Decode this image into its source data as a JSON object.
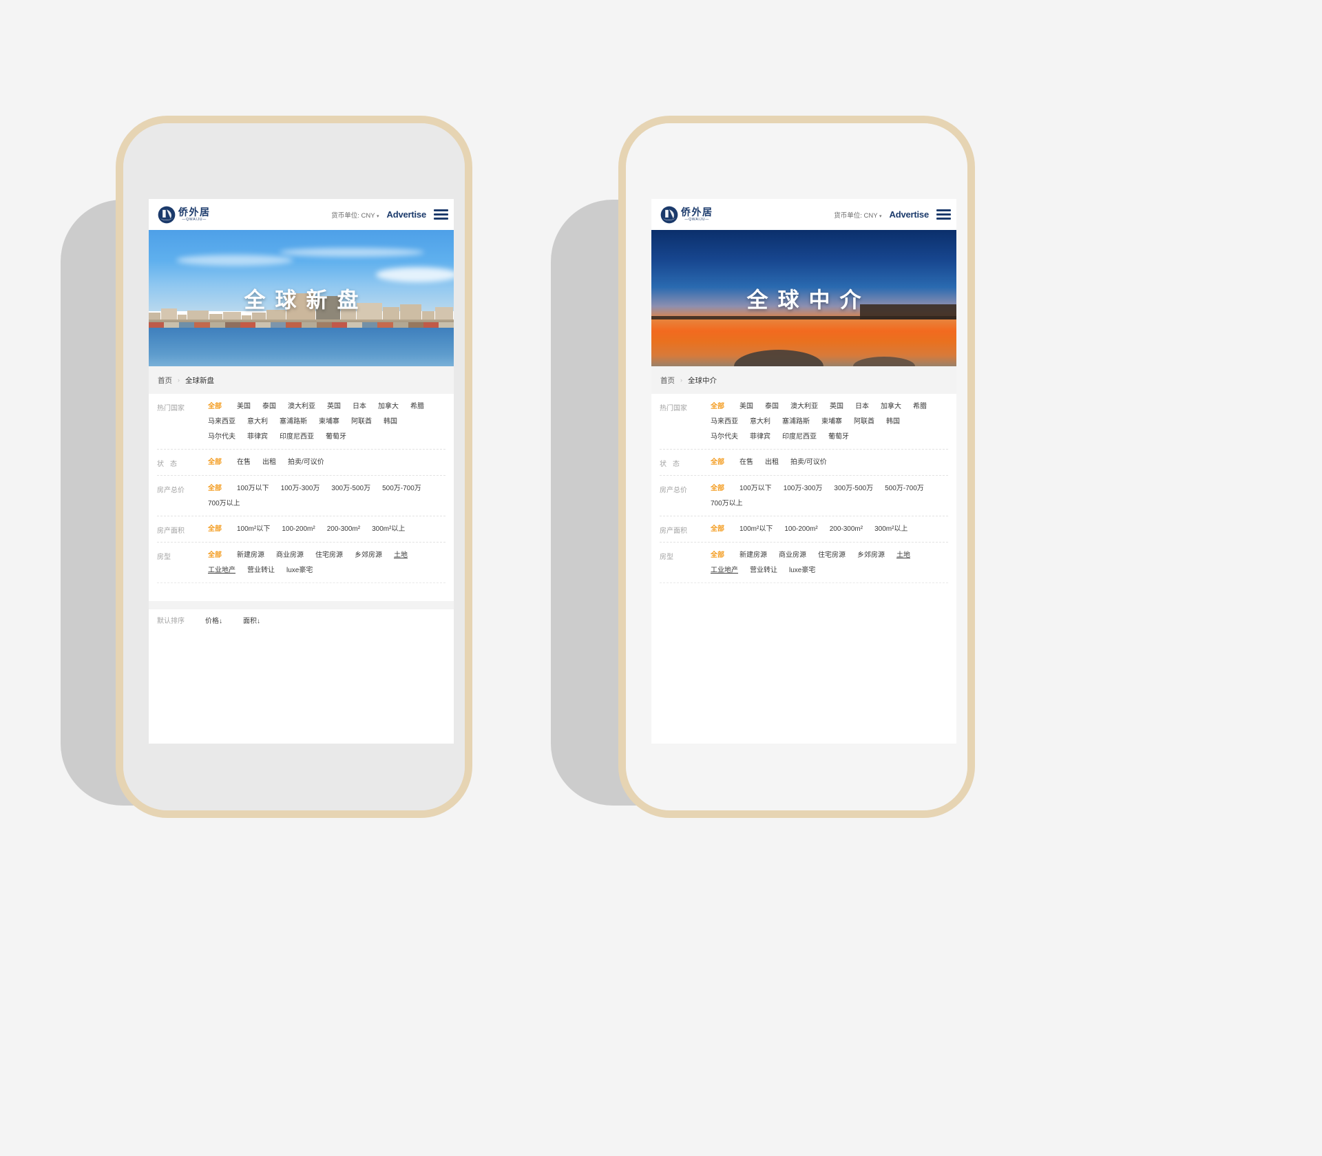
{
  "page_background": "#f4f4f4",
  "phone_frame": {
    "border_color": "#e6d4b3",
    "body_color": "#e9e9e9",
    "shadow_color": "#cccccc"
  },
  "accent_color": "#f39c20",
  "brand_color": "#1b3a6b",
  "header": {
    "logo_cn": "侨外居",
    "logo_en": "—QWAIJU—",
    "logo_mark_icon": "sail-wave-circle-icon",
    "currency_label": "货币单位: CNY",
    "currency_caret_icon": "caret-down-icon",
    "advertise_label": "Advertise",
    "menu_icon": "hamburger-menu-icon"
  },
  "screens": [
    {
      "hero_title": "全球新盘",
      "hero_style": "daylight-coastal-city",
      "breadcrumb": {
        "home": "首页",
        "separator": "›",
        "current": "全球新盘"
      },
      "filters": [
        {
          "label": "热门国家",
          "label_spaced": false,
          "options": [
            {
              "text": "全部",
              "active": true
            },
            {
              "text": "美国"
            },
            {
              "text": "泰国"
            },
            {
              "text": "澳大利亚"
            },
            {
              "text": "英国"
            },
            {
              "text": "日本"
            },
            {
              "text": "加拿大"
            },
            {
              "text": "希腊"
            },
            {
              "text": "马来西亚"
            },
            {
              "text": "意大利"
            },
            {
              "text": "塞浦路斯"
            },
            {
              "text": "柬埔寨"
            },
            {
              "text": "阿联酋"
            },
            {
              "text": "韩国"
            },
            {
              "text": "马尔代夫"
            },
            {
              "text": "菲律宾"
            },
            {
              "text": "印度尼西亚"
            },
            {
              "text": "葡萄牙"
            }
          ]
        },
        {
          "label": "状态",
          "label_spaced": true,
          "options": [
            {
              "text": "全部",
              "active": true
            },
            {
              "text": "在售"
            },
            {
              "text": "出租"
            },
            {
              "text": "拍卖/可议价"
            }
          ]
        },
        {
          "label": "房产总价",
          "label_spaced": false,
          "options": [
            {
              "text": "全部",
              "active": true
            },
            {
              "text": "100万以下"
            },
            {
              "text": "100万-300万"
            },
            {
              "text": "300万-500万"
            },
            {
              "text": "500万-700万"
            },
            {
              "text": "700万以上"
            }
          ]
        },
        {
          "label": "房产面积",
          "label_spaced": false,
          "options": [
            {
              "text": "全部",
              "active": true
            },
            {
              "text": "100m²以下"
            },
            {
              "text": "100-200m²"
            },
            {
              "text": "200-300m²"
            },
            {
              "text": "300m²以上"
            }
          ]
        },
        {
          "label": "房型",
          "label_spaced": false,
          "options": [
            {
              "text": "全部",
              "active": true
            },
            {
              "text": "新建房源"
            },
            {
              "text": "商业房源"
            },
            {
              "text": "住宅房源"
            },
            {
              "text": "乡郊房源"
            },
            {
              "text": "土地",
              "underline": true
            },
            {
              "text": "工业地产",
              "underline": true
            },
            {
              "text": "营业转让"
            },
            {
              "text": "luxe豪宅"
            }
          ]
        }
      ],
      "sort_row": {
        "label": "默认排序",
        "items": [
          "价格↓",
          "面积↓"
        ]
      }
    },
    {
      "hero_title": "全球中介",
      "hero_style": "sunset-beach",
      "breadcrumb": {
        "home": "首页",
        "separator": "›",
        "current": "全球中介"
      },
      "filters": [
        {
          "label": "热门国家",
          "label_spaced": false,
          "options": [
            {
              "text": "全部",
              "active": true
            },
            {
              "text": "美国"
            },
            {
              "text": "泰国"
            },
            {
              "text": "澳大利亚"
            },
            {
              "text": "英国"
            },
            {
              "text": "日本"
            },
            {
              "text": "加拿大"
            },
            {
              "text": "希腊"
            },
            {
              "text": "马来西亚"
            },
            {
              "text": "意大利"
            },
            {
              "text": "塞浦路斯"
            },
            {
              "text": "柬埔寨"
            },
            {
              "text": "阿联酋"
            },
            {
              "text": "韩国"
            },
            {
              "text": "马尔代夫"
            },
            {
              "text": "菲律宾"
            },
            {
              "text": "印度尼西亚"
            },
            {
              "text": "葡萄牙"
            }
          ]
        },
        {
          "label": "状态",
          "label_spaced": true,
          "options": [
            {
              "text": "全部",
              "active": true
            },
            {
              "text": "在售"
            },
            {
              "text": "出租"
            },
            {
              "text": "拍卖/可议价"
            }
          ]
        },
        {
          "label": "房产总价",
          "label_spaced": false,
          "options": [
            {
              "text": "全部",
              "active": true
            },
            {
              "text": "100万以下"
            },
            {
              "text": "100万-300万"
            },
            {
              "text": "300万-500万"
            },
            {
              "text": "500万-700万"
            },
            {
              "text": "700万以上"
            }
          ]
        },
        {
          "label": "房产面积",
          "label_spaced": false,
          "options": [
            {
              "text": "全部",
              "active": true
            },
            {
              "text": "100m²以下"
            },
            {
              "text": "100-200m²"
            },
            {
              "text": "200-300m²"
            },
            {
              "text": "300m²以上"
            }
          ]
        },
        {
          "label": "房型",
          "label_spaced": false,
          "options": [
            {
              "text": "全部",
              "active": true
            },
            {
              "text": "新建房源"
            },
            {
              "text": "商业房源"
            },
            {
              "text": "住宅房源"
            },
            {
              "text": "乡郊房源"
            },
            {
              "text": "土地",
              "underline": true
            },
            {
              "text": "工业地产",
              "underline": true
            },
            {
              "text": "营业转让"
            },
            {
              "text": "luxe豪宅"
            }
          ]
        }
      ],
      "sort_row": null
    }
  ]
}
